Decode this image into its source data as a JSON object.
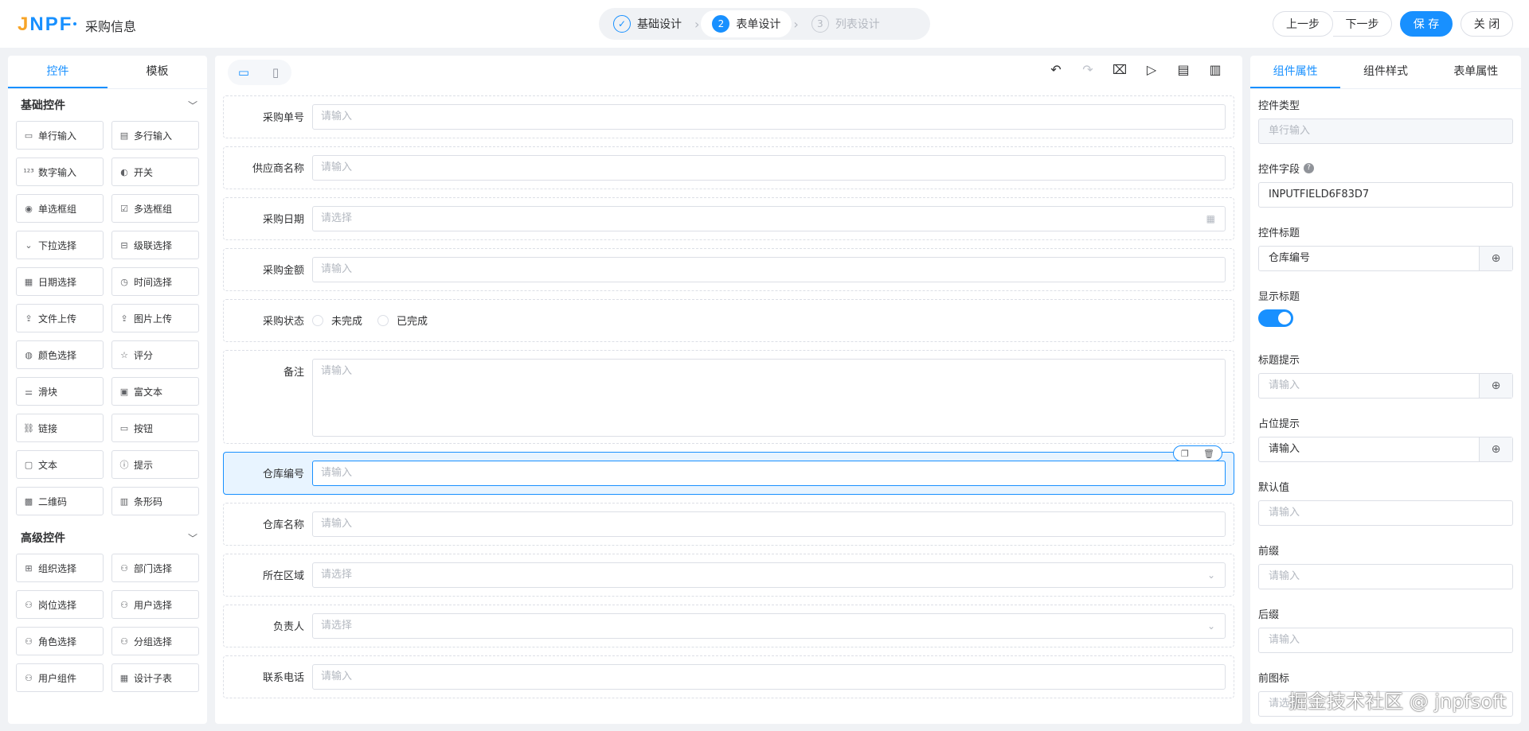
{
  "header": {
    "logo_text": "JNPF",
    "page_title": "采购信息",
    "steps": [
      {
        "num": "✓",
        "label": "基础设计",
        "state": "done"
      },
      {
        "num": "2",
        "label": "表单设计",
        "state": "active"
      },
      {
        "num": "3",
        "label": "列表设计",
        "state": "disabled"
      }
    ],
    "prev_label": "上一步",
    "next_label": "下一步",
    "save_label": "保 存",
    "close_label": "关 闭"
  },
  "left_panel": {
    "tabs": [
      "控件",
      "模板"
    ],
    "basic_title": "基础控件",
    "basic_items": [
      {
        "icon": "▭",
        "label": "单行输入"
      },
      {
        "icon": "▤",
        "label": "多行输入"
      },
      {
        "icon": "¹²³",
        "label": "数字输入"
      },
      {
        "icon": "◐",
        "label": "开关"
      },
      {
        "icon": "◉",
        "label": "单选框组"
      },
      {
        "icon": "☑",
        "label": "多选框组"
      },
      {
        "icon": "⌄",
        "label": "下拉选择"
      },
      {
        "icon": "⊟",
        "label": "级联选择"
      },
      {
        "icon": "▦",
        "label": "日期选择"
      },
      {
        "icon": "◷",
        "label": "时间选择"
      },
      {
        "icon": "⇪",
        "label": "文件上传"
      },
      {
        "icon": "⇪",
        "label": "图片上传"
      },
      {
        "icon": "◍",
        "label": "颜色选择"
      },
      {
        "icon": "☆",
        "label": "评分"
      },
      {
        "icon": "⚌",
        "label": "滑块"
      },
      {
        "icon": "▣",
        "label": "富文本"
      },
      {
        "icon": "⛓",
        "label": "链接"
      },
      {
        "icon": "▭",
        "label": "按钮"
      },
      {
        "icon": "▢",
        "label": "文本"
      },
      {
        "icon": "ⓘ",
        "label": "提示"
      },
      {
        "icon": "▩",
        "label": "二维码"
      },
      {
        "icon": "▥",
        "label": "条形码"
      }
    ],
    "advanced_title": "高级控件",
    "advanced_items": [
      {
        "icon": "⊞",
        "label": "组织选择"
      },
      {
        "icon": "⚇",
        "label": "部门选择"
      },
      {
        "icon": "⚇",
        "label": "岗位选择"
      },
      {
        "icon": "⚇",
        "label": "用户选择"
      },
      {
        "icon": "⚇",
        "label": "角色选择"
      },
      {
        "icon": "⚇",
        "label": "分组选择"
      },
      {
        "icon": "⚇",
        "label": "用户组件"
      },
      {
        "icon": "▦",
        "label": "设计子表"
      }
    ]
  },
  "canvas": {
    "fields": [
      {
        "label": "采购单号",
        "type": "input",
        "placeholder": "请输入"
      },
      {
        "label": "供应商名称",
        "type": "input",
        "placeholder": "请输入"
      },
      {
        "label": "采购日期",
        "type": "date",
        "placeholder": "请选择"
      },
      {
        "label": "采购金额",
        "type": "input",
        "placeholder": "请输入"
      },
      {
        "label": "采购状态",
        "type": "radio",
        "options": [
          "未完成",
          "已完成"
        ]
      },
      {
        "label": "备注",
        "type": "textarea",
        "placeholder": "请输入"
      },
      {
        "label": "仓库编号",
        "type": "input",
        "placeholder": "请输入",
        "selected": true
      },
      {
        "label": "仓库名称",
        "type": "input",
        "placeholder": "请输入"
      },
      {
        "label": "所在区域",
        "type": "select",
        "placeholder": "请选择"
      },
      {
        "label": "负责人",
        "type": "select",
        "placeholder": "请选择"
      },
      {
        "label": "联系电话",
        "type": "input",
        "placeholder": "请输入"
      }
    ]
  },
  "right_panel": {
    "tabs": [
      "组件属性",
      "组件样式",
      "表单属性"
    ],
    "props": [
      {
        "label": "控件类型",
        "value": "单行输入",
        "kind": "disabled"
      },
      {
        "label": "控件字段",
        "value": "INPUTFIELD6F83D7",
        "kind": "value",
        "help": true
      },
      {
        "label": "控件标题",
        "value": "仓库编号",
        "kind": "value",
        "append": "globe"
      },
      {
        "label": "显示标题",
        "kind": "toggle"
      },
      {
        "label": "标题提示",
        "value": "请输入",
        "kind": "placeholder",
        "append": "globe"
      },
      {
        "label": "占位提示",
        "value": "请输入",
        "kind": "value",
        "append": "globe"
      },
      {
        "label": "默认值",
        "value": "请输入",
        "kind": "placeholder"
      },
      {
        "label": "前缀",
        "value": "请输入",
        "kind": "placeholder"
      },
      {
        "label": "后缀",
        "value": "请输入",
        "kind": "placeholder"
      },
      {
        "label": "前图标",
        "value": "请选择",
        "kind": "placeholder"
      }
    ]
  },
  "watermark": "掘金技术社区 @ jnpfsoft",
  "colors": {
    "accent": "#1890ff",
    "logo_orange": "#f7a427"
  }
}
